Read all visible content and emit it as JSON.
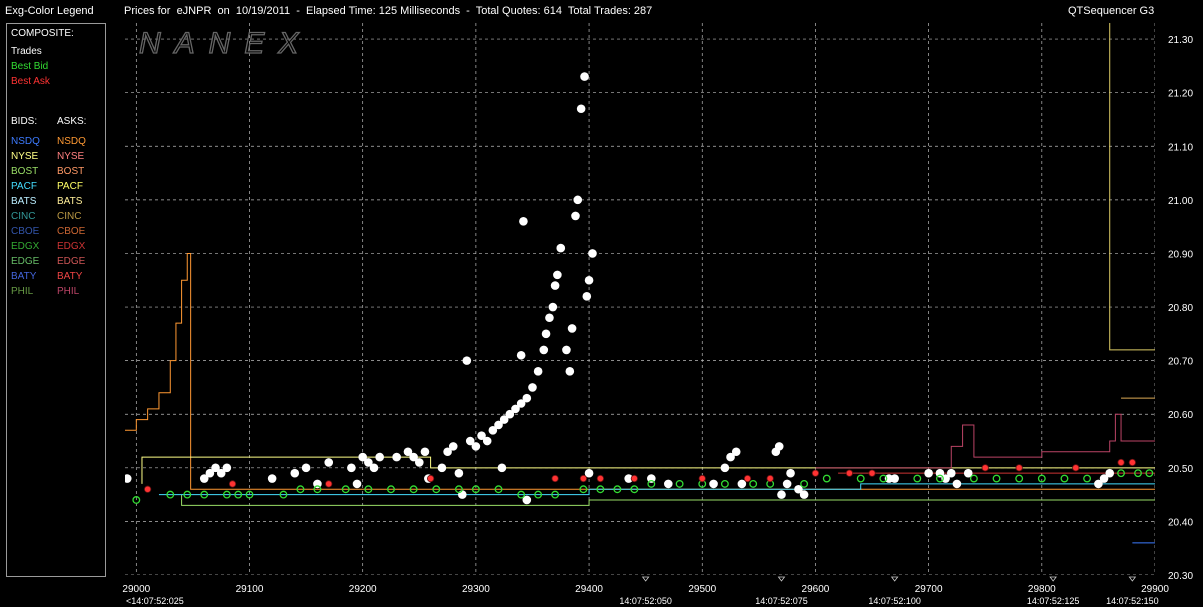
{
  "header": {
    "legend_title": "Exg-Color Legend",
    "chart_title": "Prices for  eJNPR  on  10/19/2011  -  Elapsed Time: 125 Milliseconds  -  Total Quotes: 614  Total Trades: 287",
    "app_name": "QTSequencer G3"
  },
  "legend": {
    "composite_label": "COMPOSITE:",
    "composite": [
      {
        "label": "Trades",
        "color": "#ffffff"
      },
      {
        "label": "Best Bid",
        "color": "#33dd33"
      },
      {
        "label": "Best Ask",
        "color": "#ff3333"
      }
    ],
    "bids_label": "BIDS:",
    "asks_label": "ASKS:",
    "exchanges": [
      {
        "bid": "NSDQ",
        "ask": "NSDQ",
        "bid_color": "#3d7bff",
        "ask_color": "#ff9933"
      },
      {
        "bid": "NYSE",
        "ask": "NYSE",
        "bid_color": "#ffff88",
        "ask_color": "#ff8080"
      },
      {
        "bid": "BOST",
        "ask": "BOST",
        "bid_color": "#99dd66",
        "ask_color": "#ff9966"
      },
      {
        "bid": "PACF",
        "ask": "PACF",
        "bid_color": "#44ddff",
        "ask_color": "#ffff66"
      },
      {
        "bid": "BATS",
        "ask": "BATS",
        "bid_color": "#bbeeff",
        "ask_color": "#ffee99"
      },
      {
        "bid": "CINC",
        "ask": "CINC",
        "bid_color": "#339999",
        "ask_color": "#bb9944"
      },
      {
        "bid": "CBOE",
        "ask": "CBOE",
        "bid_color": "#3355aa",
        "ask_color": "#cc6633"
      },
      {
        "bid": "EDGX",
        "ask": "EDGX",
        "bid_color": "#33aa33",
        "ask_color": "#cc3333"
      },
      {
        "bid": "EDGE",
        "ask": "EDGE",
        "bid_color": "#66bb66",
        "ask_color": "#cc5555"
      },
      {
        "bid": "BATY",
        "ask": "BATY",
        "bid_color": "#4466dd",
        "ask_color": "#ee4444"
      },
      {
        "bid": "PHIL",
        "ask": "PHIL",
        "bid_color": "#669944",
        "ask_color": "#bb4466"
      }
    ]
  },
  "watermark": "NANEX",
  "chart_data": {
    "type": "scatter",
    "grid": true,
    "xlim": [
      28990,
      29900
    ],
    "ylim": [
      20.3,
      21.33
    ],
    "x_ticks": [
      29000,
      29100,
      29200,
      29300,
      29400,
      29500,
      29600,
      29700,
      29800,
      29900
    ],
    "x_tick_labels": [
      "29000",
      "29100",
      "29200",
      "29300",
      "29400",
      "29500",
      "29600",
      "29700",
      "29800",
      "29900"
    ],
    "y_ticks": [
      20.3,
      20.4,
      20.5,
      20.6,
      20.7,
      20.8,
      20.9,
      21.0,
      21.1,
      21.2,
      21.3
    ],
    "y_tick_labels": [
      "20.30",
      "20.40",
      "20.50",
      "20.60",
      "20.70",
      "20.80",
      "20.90",
      "21.00",
      "21.10",
      "21.20",
      "21.30"
    ],
    "time_labels": [
      {
        "x": 29000,
        "label": "<14:07:52:025"
      },
      {
        "x": 29450,
        "label": "14:07:52:050"
      },
      {
        "x": 29570,
        "label": "14:07:52:075"
      },
      {
        "x": 29670,
        "label": "14:07:52:100"
      },
      {
        "x": 29810,
        "label": "14:07:52:125"
      },
      {
        "x": 29880,
        "label": "14:07:52:150"
      }
    ],
    "series": [
      {
        "name": "Trades",
        "color": "#ffffff",
        "points": [
          [
            28992,
            20.48
          ],
          [
            29060,
            20.48
          ],
          [
            29065,
            20.49
          ],
          [
            29070,
            20.5
          ],
          [
            29075,
            20.49
          ],
          [
            29080,
            20.5
          ],
          [
            29120,
            20.48
          ],
          [
            29140,
            20.49
          ],
          [
            29150,
            20.5
          ],
          [
            29160,
            20.47
          ],
          [
            29170,
            20.51
          ],
          [
            29190,
            20.5
          ],
          [
            29195,
            20.47
          ],
          [
            29200,
            20.52
          ],
          [
            29205,
            20.51
          ],
          [
            29210,
            20.5
          ],
          [
            29215,
            20.52
          ],
          [
            29230,
            20.52
          ],
          [
            29240,
            20.53
          ],
          [
            29245,
            20.52
          ],
          [
            29250,
            20.51
          ],
          [
            29255,
            20.53
          ],
          [
            29258,
            20.48
          ],
          [
            29270,
            20.5
          ],
          [
            29275,
            20.53
          ],
          [
            29280,
            20.54
          ],
          [
            29285,
            20.49
          ],
          [
            29288,
            20.45
          ],
          [
            29295,
            20.55
          ],
          [
            29300,
            20.54
          ],
          [
            29305,
            20.56
          ],
          [
            29310,
            20.55
          ],
          [
            29315,
            20.57
          ],
          [
            29320,
            20.58
          ],
          [
            29325,
            20.59
          ],
          [
            29330,
            20.6
          ],
          [
            29335,
            20.61
          ],
          [
            29340,
            20.62
          ],
          [
            29345,
            20.63
          ],
          [
            29350,
            20.65
          ],
          [
            29355,
            20.68
          ],
          [
            29360,
            20.72
          ],
          [
            29362,
            20.75
          ],
          [
            29365,
            20.78
          ],
          [
            29368,
            20.8
          ],
          [
            29370,
            20.84
          ],
          [
            29372,
            20.86
          ],
          [
            29375,
            20.91
          ],
          [
            29380,
            20.72
          ],
          [
            29383,
            20.68
          ],
          [
            29385,
            20.76
          ],
          [
            29388,
            20.97
          ],
          [
            29390,
            21.0
          ],
          [
            29393,
            21.17
          ],
          [
            29396,
            21.23
          ],
          [
            29398,
            20.82
          ],
          [
            29400,
            20.85
          ],
          [
            29403,
            20.9
          ],
          [
            29292,
            20.7
          ],
          [
            29340,
            20.71
          ],
          [
            29342,
            20.96
          ],
          [
            29323,
            20.5
          ],
          [
            29345,
            20.44
          ],
          [
            29400,
            20.49
          ],
          [
            29435,
            20.48
          ],
          [
            29455,
            20.48
          ],
          [
            29470,
            20.47
          ],
          [
            29510,
            20.47
          ],
          [
            29520,
            20.5
          ],
          [
            29525,
            20.52
          ],
          [
            29530,
            20.53
          ],
          [
            29535,
            20.47
          ],
          [
            29565,
            20.53
          ],
          [
            29568,
            20.54
          ],
          [
            29570,
            20.45
          ],
          [
            29575,
            20.47
          ],
          [
            29578,
            20.49
          ],
          [
            29585,
            20.46
          ],
          [
            29590,
            20.45
          ],
          [
            29665,
            20.48
          ],
          [
            29670,
            20.48
          ],
          [
            29700,
            20.49
          ],
          [
            29710,
            20.49
          ],
          [
            29715,
            20.48
          ],
          [
            29720,
            20.49
          ],
          [
            29725,
            20.47
          ],
          [
            29735,
            20.49
          ],
          [
            29850,
            20.47
          ],
          [
            29855,
            20.48
          ],
          [
            29860,
            20.49
          ]
        ]
      },
      {
        "name": "Best Bid",
        "color": "#33dd33",
        "points": [
          [
            29000,
            20.44
          ],
          [
            29030,
            20.45
          ],
          [
            29045,
            20.45
          ],
          [
            29060,
            20.45
          ],
          [
            29080,
            20.45
          ],
          [
            29090,
            20.45
          ],
          [
            29100,
            20.45
          ],
          [
            29130,
            20.45
          ],
          [
            29145,
            20.46
          ],
          [
            29160,
            20.46
          ],
          [
            29185,
            20.46
          ],
          [
            29205,
            20.46
          ],
          [
            29225,
            20.46
          ],
          [
            29245,
            20.46
          ],
          [
            29265,
            20.46
          ],
          [
            29285,
            20.46
          ],
          [
            29300,
            20.46
          ],
          [
            29320,
            20.46
          ],
          [
            29340,
            20.45
          ],
          [
            29355,
            20.45
          ],
          [
            29370,
            20.45
          ],
          [
            29395,
            20.46
          ],
          [
            29410,
            20.46
          ],
          [
            29425,
            20.46
          ],
          [
            29440,
            20.46
          ],
          [
            29455,
            20.47
          ],
          [
            29480,
            20.47
          ],
          [
            29500,
            20.47
          ],
          [
            29520,
            20.47
          ],
          [
            29545,
            20.47
          ],
          [
            29560,
            20.47
          ],
          [
            29590,
            20.47
          ],
          [
            29610,
            20.48
          ],
          [
            29640,
            20.48
          ],
          [
            29660,
            20.48
          ],
          [
            29690,
            20.48
          ],
          [
            29710,
            20.48
          ],
          [
            29740,
            20.48
          ],
          [
            29760,
            20.48
          ],
          [
            29780,
            20.48
          ],
          [
            29800,
            20.48
          ],
          [
            29820,
            20.48
          ],
          [
            29840,
            20.48
          ],
          [
            29870,
            20.49
          ],
          [
            29885,
            20.49
          ],
          [
            29895,
            20.49
          ]
        ]
      },
      {
        "name": "Best Ask",
        "color": "#ff3333",
        "points": [
          [
            29010,
            20.46
          ],
          [
            29085,
            20.47
          ],
          [
            29170,
            20.47
          ],
          [
            29260,
            20.48
          ],
          [
            29370,
            20.48
          ],
          [
            29395,
            20.48
          ],
          [
            29410,
            20.48
          ],
          [
            29440,
            20.48
          ],
          [
            29500,
            20.48
          ],
          [
            29540,
            20.48
          ],
          [
            29560,
            20.48
          ],
          [
            29600,
            20.49
          ],
          [
            29630,
            20.49
          ],
          [
            29650,
            20.49
          ],
          [
            29750,
            20.5
          ],
          [
            29780,
            20.5
          ],
          [
            29830,
            20.5
          ],
          [
            29870,
            20.51
          ],
          [
            29880,
            20.51
          ]
        ]
      }
    ]
  }
}
